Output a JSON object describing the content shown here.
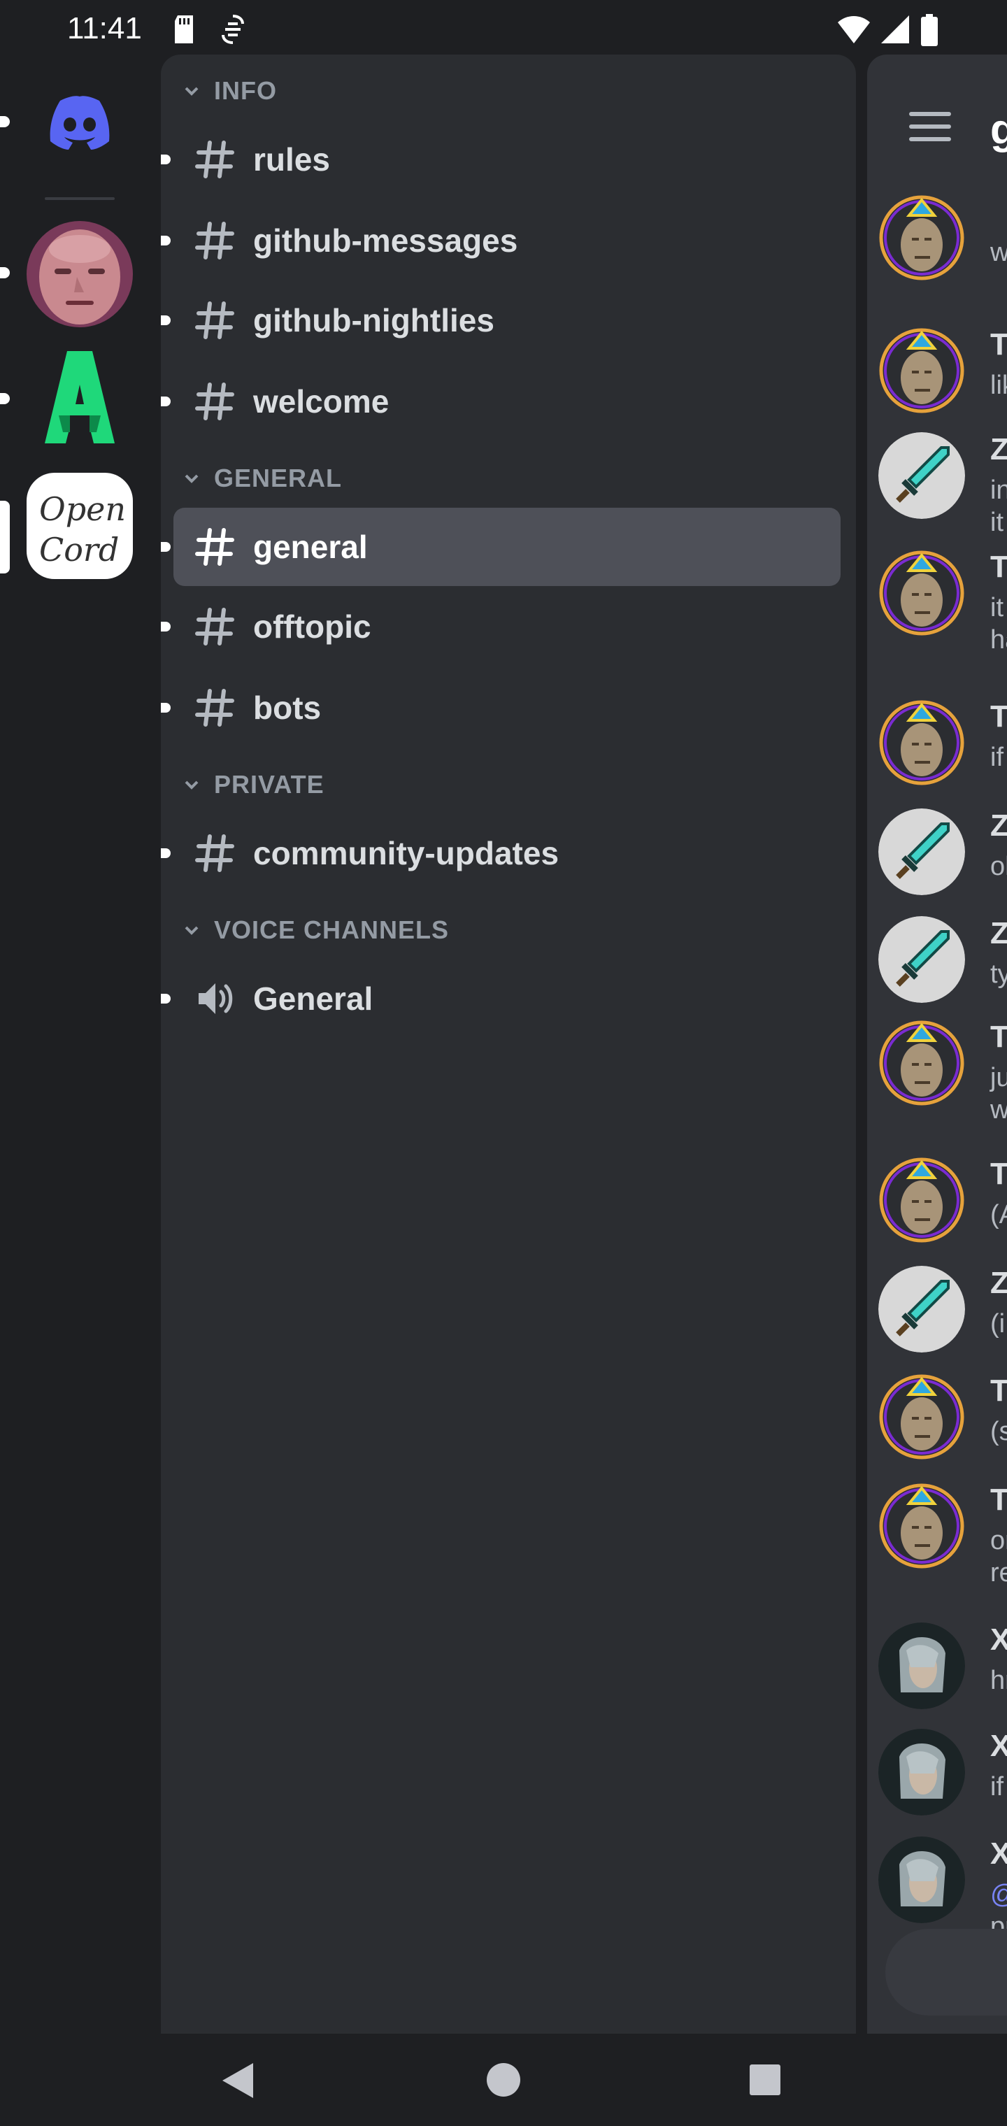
{
  "status_bar": {
    "time": "11:41",
    "icons": [
      "sd-card-icon",
      "vpn-icon",
      "wifi-icon",
      "signal-icon",
      "battery-icon"
    ]
  },
  "servers": [
    {
      "name": "discord-home-icon",
      "unread": true
    },
    {
      "name": "server-avatar-face",
      "unread": true
    },
    {
      "name": "server-avatar-green-a",
      "unread": true
    },
    {
      "name": "server-opencord",
      "logo_text": "Open Cord",
      "selected": true
    }
  ],
  "channels": {
    "categories": [
      {
        "label": "INFO",
        "channels": [
          {
            "label": "rules",
            "type": "text"
          },
          {
            "label": "github-messages",
            "type": "text"
          },
          {
            "label": "github-nightlies",
            "type": "text"
          },
          {
            "label": "welcome",
            "type": "text"
          }
        ]
      },
      {
        "label": "GENERAL",
        "channels": [
          {
            "label": "general",
            "type": "text",
            "selected": true
          },
          {
            "label": "offtopic",
            "type": "text"
          },
          {
            "label": "bots",
            "type": "text"
          }
        ]
      },
      {
        "label": "PRIVATE",
        "channels": [
          {
            "label": "community-updates",
            "type": "text"
          }
        ]
      },
      {
        "label": "VOICE CHANNELS",
        "channels": [
          {
            "label": "General",
            "type": "voice"
          }
        ]
      }
    ]
  },
  "chat": {
    "header_title": "g",
    "messages": [
      {
        "author": "",
        "lines": [
          "w"
        ],
        "avatar": "meme-face-avatar"
      },
      {
        "author": "Ty",
        "lines": [
          "lik"
        ],
        "avatar": "meme-face-avatar"
      },
      {
        "author": "Z",
        "lines": [
          "in",
          "it"
        ],
        "avatar": "diamond-sword-avatar"
      },
      {
        "author": "Ty",
        "lines": [
          "it",
          "ha"
        ],
        "avatar": "meme-face-avatar"
      },
      {
        "author": "Ty",
        "lines": [
          "if"
        ],
        "avatar": "meme-face-avatar"
      },
      {
        "author": "Z",
        "lines": [
          "oh"
        ],
        "avatar": "diamond-sword-avatar"
      },
      {
        "author": "Z",
        "lines": [
          "ty"
        ],
        "avatar": "diamond-sword-avatar"
      },
      {
        "author": "Ty",
        "lines": [
          "ju",
          "w"
        ],
        "avatar": "meme-face-avatar"
      },
      {
        "author": "Ty",
        "lines": [
          "(A"
        ],
        "avatar": "meme-face-avatar"
      },
      {
        "author": "Z",
        "lines": [
          "(i"
        ],
        "avatar": "diamond-sword-avatar"
      },
      {
        "author": "Ty",
        "lines": [
          "(s"
        ],
        "avatar": "meme-face-avatar"
      },
      {
        "author": "Ty",
        "lines": [
          "or",
          "re"
        ],
        "avatar": "meme-face-avatar"
      },
      {
        "author": "Xi",
        "lines": [
          "hr"
        ],
        "avatar": "silver-hair-avatar"
      },
      {
        "author": "Xi",
        "lines": [
          "if"
        ],
        "avatar": "silver-hair-avatar"
      },
      {
        "author": "Xi",
        "lines": [
          "@",
          "pr"
        ],
        "avatar": "silver-hair-avatar"
      }
    ]
  },
  "colors": {
    "background": "#1e1f22",
    "channel_panel": "#2b2d31",
    "chat_panel": "#313338",
    "selected_channel": "#4e5058",
    "discord_blurple": "#5865f2",
    "category_text": "#949ba4"
  },
  "nav_bar": {
    "icons": [
      "back-icon",
      "home-icon",
      "recents-icon"
    ]
  }
}
